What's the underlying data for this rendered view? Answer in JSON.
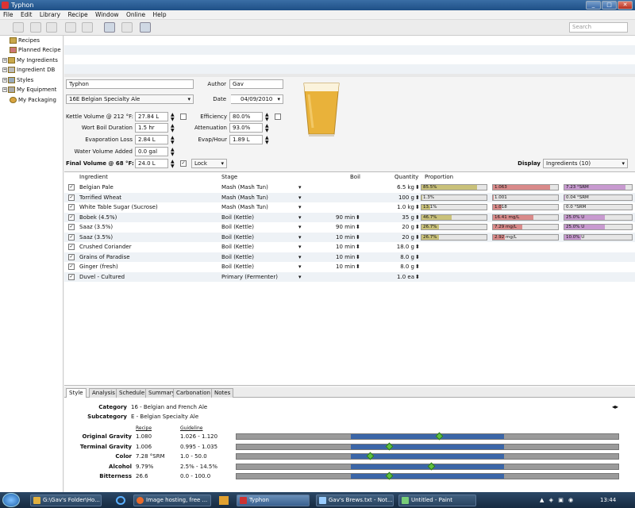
{
  "window": {
    "title": "Typhon",
    "controls": [
      "_",
      "□",
      "✕"
    ]
  },
  "menu": [
    "File",
    "Edit",
    "Library",
    "Recipe",
    "Window",
    "Online",
    "Help"
  ],
  "search": {
    "placeholder": "Search"
  },
  "sidebar": {
    "items": [
      {
        "label": "Recipes",
        "expandable": false
      },
      {
        "label": "Planned Recipe",
        "expandable": false
      },
      {
        "label": "My Ingredients",
        "expandable": true
      },
      {
        "label": "Ingredient DB",
        "expandable": true
      },
      {
        "label": "Styles",
        "expandable": true
      },
      {
        "label": "My Equipment",
        "expandable": true
      },
      {
        "label": "My Packaging",
        "expandable": false
      }
    ]
  },
  "recipe": {
    "name": "Typhon",
    "author_label": "Author",
    "author": "Gav",
    "style": "16E Belgian Specialty Ale",
    "date_label": "Date",
    "date": "04/09/2010",
    "date_checked": true
  },
  "params": {
    "kettle_volume": {
      "label": "Kettle Volume @ 212 °F:",
      "value": "27.84 L"
    },
    "boil_duration": {
      "label": "Wort Boil Duration",
      "value": "1.5 hr"
    },
    "evaporation_loss": {
      "label": "Evaporation Loss",
      "value": "2.84 L"
    },
    "water_added": {
      "label": "Water Volume Added",
      "value": "0.0 gal"
    },
    "final_volume": {
      "label": "Final Volume @ 68 °F:",
      "value": "24.0 L"
    },
    "efficiency": {
      "label": "Efficiency",
      "value": "80.0%"
    },
    "attenuation": {
      "label": "Attenuation",
      "value": "93.0%"
    },
    "evap_hour": {
      "label": "Evap/Hour",
      "value": "1.89 L"
    },
    "lock": "Lock",
    "display_label": "Display",
    "display_value": "Ingredients (10)"
  },
  "grid": {
    "headers": {
      "ingredient": "Ingredient",
      "stage": "Stage",
      "boil": "Boil",
      "quantity": "Quantity",
      "proportion": "Proportion"
    },
    "rows": [
      {
        "checked": true,
        "name": "Belgian Pale",
        "stage": "Mash (Mash Tun)",
        "boil": "",
        "qty": "6.5 kg",
        "p1": "85.5%",
        "p1v": 0.855,
        "p2": "1.063",
        "p2v": 0.88,
        "p3": "7.23 °SRM",
        "p3v": 0.9
      },
      {
        "checked": true,
        "name": "Torrified Wheat",
        "stage": "Mash (Mash Tun)",
        "boil": "",
        "qty": "100 g",
        "p1": "1.3%",
        "p1v": 0.013,
        "p2": "1.001",
        "p2v": 0.01,
        "p3": "0.04 °SRM",
        "p3v": 0.005
      },
      {
        "checked": true,
        "name": "White Table Sugar (Sucrose)",
        "stage": "Mash (Mash Tun)",
        "boil": "",
        "qty": "1.0 kg",
        "p1": "13.1%",
        "p1v": 0.131,
        "p2": "1.018",
        "p2v": 0.14,
        "p3": "0.0 °SRM",
        "p3v": 0
      },
      {
        "checked": true,
        "name": "Bobek (4.5%)",
        "stage": "Boil (Kettle)",
        "boil": "90 min",
        "qty": "35 g",
        "p1": "46.7%",
        "p1v": 0.467,
        "p2": "16.41 mg/L",
        "p2v": 0.62,
        "p3": "25.0% U",
        "p3v": 0.6
      },
      {
        "checked": true,
        "name": "Saaz (3.5%)",
        "stage": "Boil (Kettle)",
        "boil": "90 min",
        "qty": "20 g",
        "p1": "26.7%",
        "p1v": 0.267,
        "p2": "7.29 mg/L",
        "p2v": 0.45,
        "p3": "25.0% U",
        "p3v": 0.6
      },
      {
        "checked": true,
        "name": "Saaz (3.5%)",
        "stage": "Boil (Kettle)",
        "boil": "10 min",
        "qty": "20 g",
        "p1": "26.7%",
        "p1v": 0.267,
        "p2": "2.92 mg/L",
        "p2v": 0.18,
        "p3": "10.0% U",
        "p3v": 0.25
      },
      {
        "checked": true,
        "name": "Crushed Coriander",
        "stage": "Boil (Kettle)",
        "boil": "10 min",
        "qty": "18.0 g"
      },
      {
        "checked": true,
        "name": "Grains of Paradise",
        "stage": "Boil (Kettle)",
        "boil": "10 min",
        "qty": "8.0 g"
      },
      {
        "checked": true,
        "name": "Ginger (fresh)",
        "stage": "Boil (Kettle)",
        "boil": "10 min",
        "qty": "8.0 g"
      },
      {
        "checked": true,
        "name": "Duvel - Cultured",
        "stage": "Primary (Fermenter)",
        "boil": "",
        "qty": "1.0 ea"
      }
    ]
  },
  "tabs": [
    "Style",
    "Analysis",
    "Schedule",
    "Summary",
    "Carbonation",
    "Notes"
  ],
  "style": {
    "category_label": "Category",
    "category": "16 - Belgian and French Ale",
    "subcategory_label": "Subcategory",
    "subcategory": "E - Belgian Specialty Ale",
    "recipe_head": "Recipe",
    "guideline_head": "Guideline",
    "stats": [
      {
        "label": "Original Gravity",
        "recipe": "1.080",
        "guide": "1.026 - 1.120",
        "range": [
          0.3,
          0.7
        ],
        "marker": 0.53
      },
      {
        "label": "Terminal Gravity",
        "recipe": "1.006",
        "guide": "0.995 - 1.035",
        "range": [
          0.3,
          0.7
        ],
        "marker": 0.4
      },
      {
        "label": "Color",
        "recipe": "7.28 °SRM",
        "guide": "1.0 - 50.0",
        "range": [
          0.3,
          0.7
        ],
        "marker": 0.35
      },
      {
        "label": "Alcohol",
        "recipe": "9.79%",
        "guide": "2.5% - 14.5%",
        "range": [
          0.3,
          0.7
        ],
        "marker": 0.51
      },
      {
        "label": "Bitterness",
        "recipe": "26.6",
        "guide": "0.0 - 100.0",
        "range": [
          0.3,
          0.7
        ],
        "marker": 0.4
      }
    ]
  },
  "taskbar": {
    "items": [
      "G:\\Gav's Folder\\Ho...",
      "Image hosting, free ...",
      "Typhon",
      "Gav's Brews.txt - Not...",
      "Untitled - Paint"
    ],
    "clock": "13:44"
  },
  "colors": {
    "accent": "#3b66a8",
    "marker": "#5fbf3f",
    "p1": "#c9c17a",
    "p2": "#d98a8a",
    "p3": "#c89ad0"
  }
}
